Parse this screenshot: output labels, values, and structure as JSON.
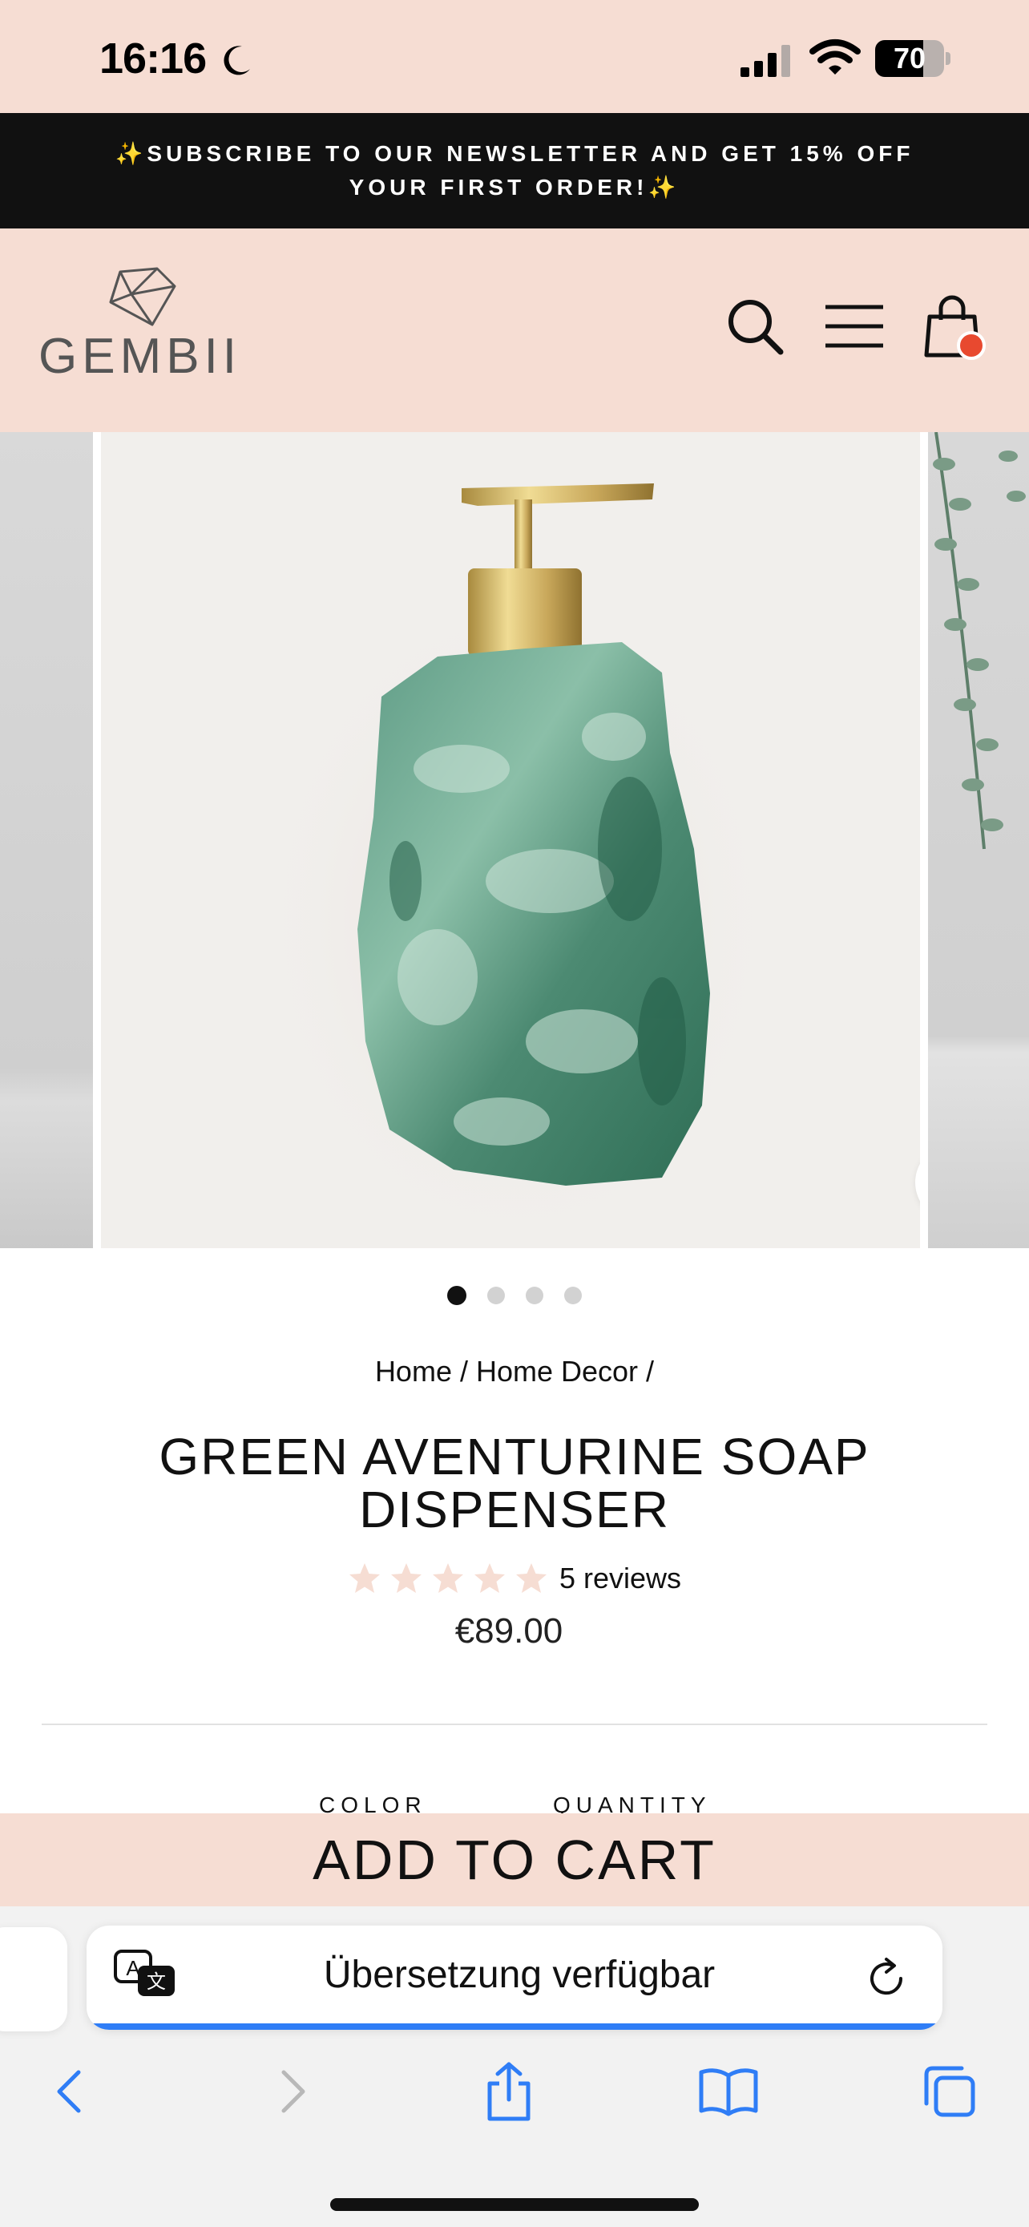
{
  "status_bar": {
    "time": "16:16",
    "battery_level": "70",
    "battery_fraction": 0.7
  },
  "announcement": {
    "text": "✨SUBSCRIBE TO OUR NEWSLETTER AND GET 15% OFF YOUR FIRST ORDER!✨"
  },
  "header": {
    "logo_text": "GEMBII"
  },
  "gallery": {
    "slide_count": 4,
    "active_slide": 1
  },
  "product": {
    "breadcrumb": "Home / Home Decor /",
    "title": "GREEN AVENTURINE SOAP DISPENSER",
    "rating_stars": 5,
    "reviews": "5 reviews",
    "price": "€89.00",
    "color_label": "COLOR",
    "quantity_label": "QUANTITY",
    "add_to_cart": "ADD TO CART"
  },
  "browser": {
    "address_text": "Übersetzung verfügbar",
    "load_progress": 1.0
  },
  "colors": {
    "header_bg": "#f6ddd3",
    "announcement_bg": "#111111",
    "cart_badge": "#e8492f",
    "star_color": "#f6ddd3",
    "safari_accent": "#2f7df6"
  },
  "icons": {
    "status": [
      "moon-icon",
      "signal-icon",
      "wifi-icon",
      "battery-icon"
    ],
    "header": [
      "search-icon",
      "menu-icon",
      "cart-icon"
    ],
    "safari": [
      "translate-icon",
      "reload-icon",
      "back-icon",
      "forward-icon",
      "share-icon",
      "bookmarks-icon",
      "tabs-icon"
    ]
  }
}
